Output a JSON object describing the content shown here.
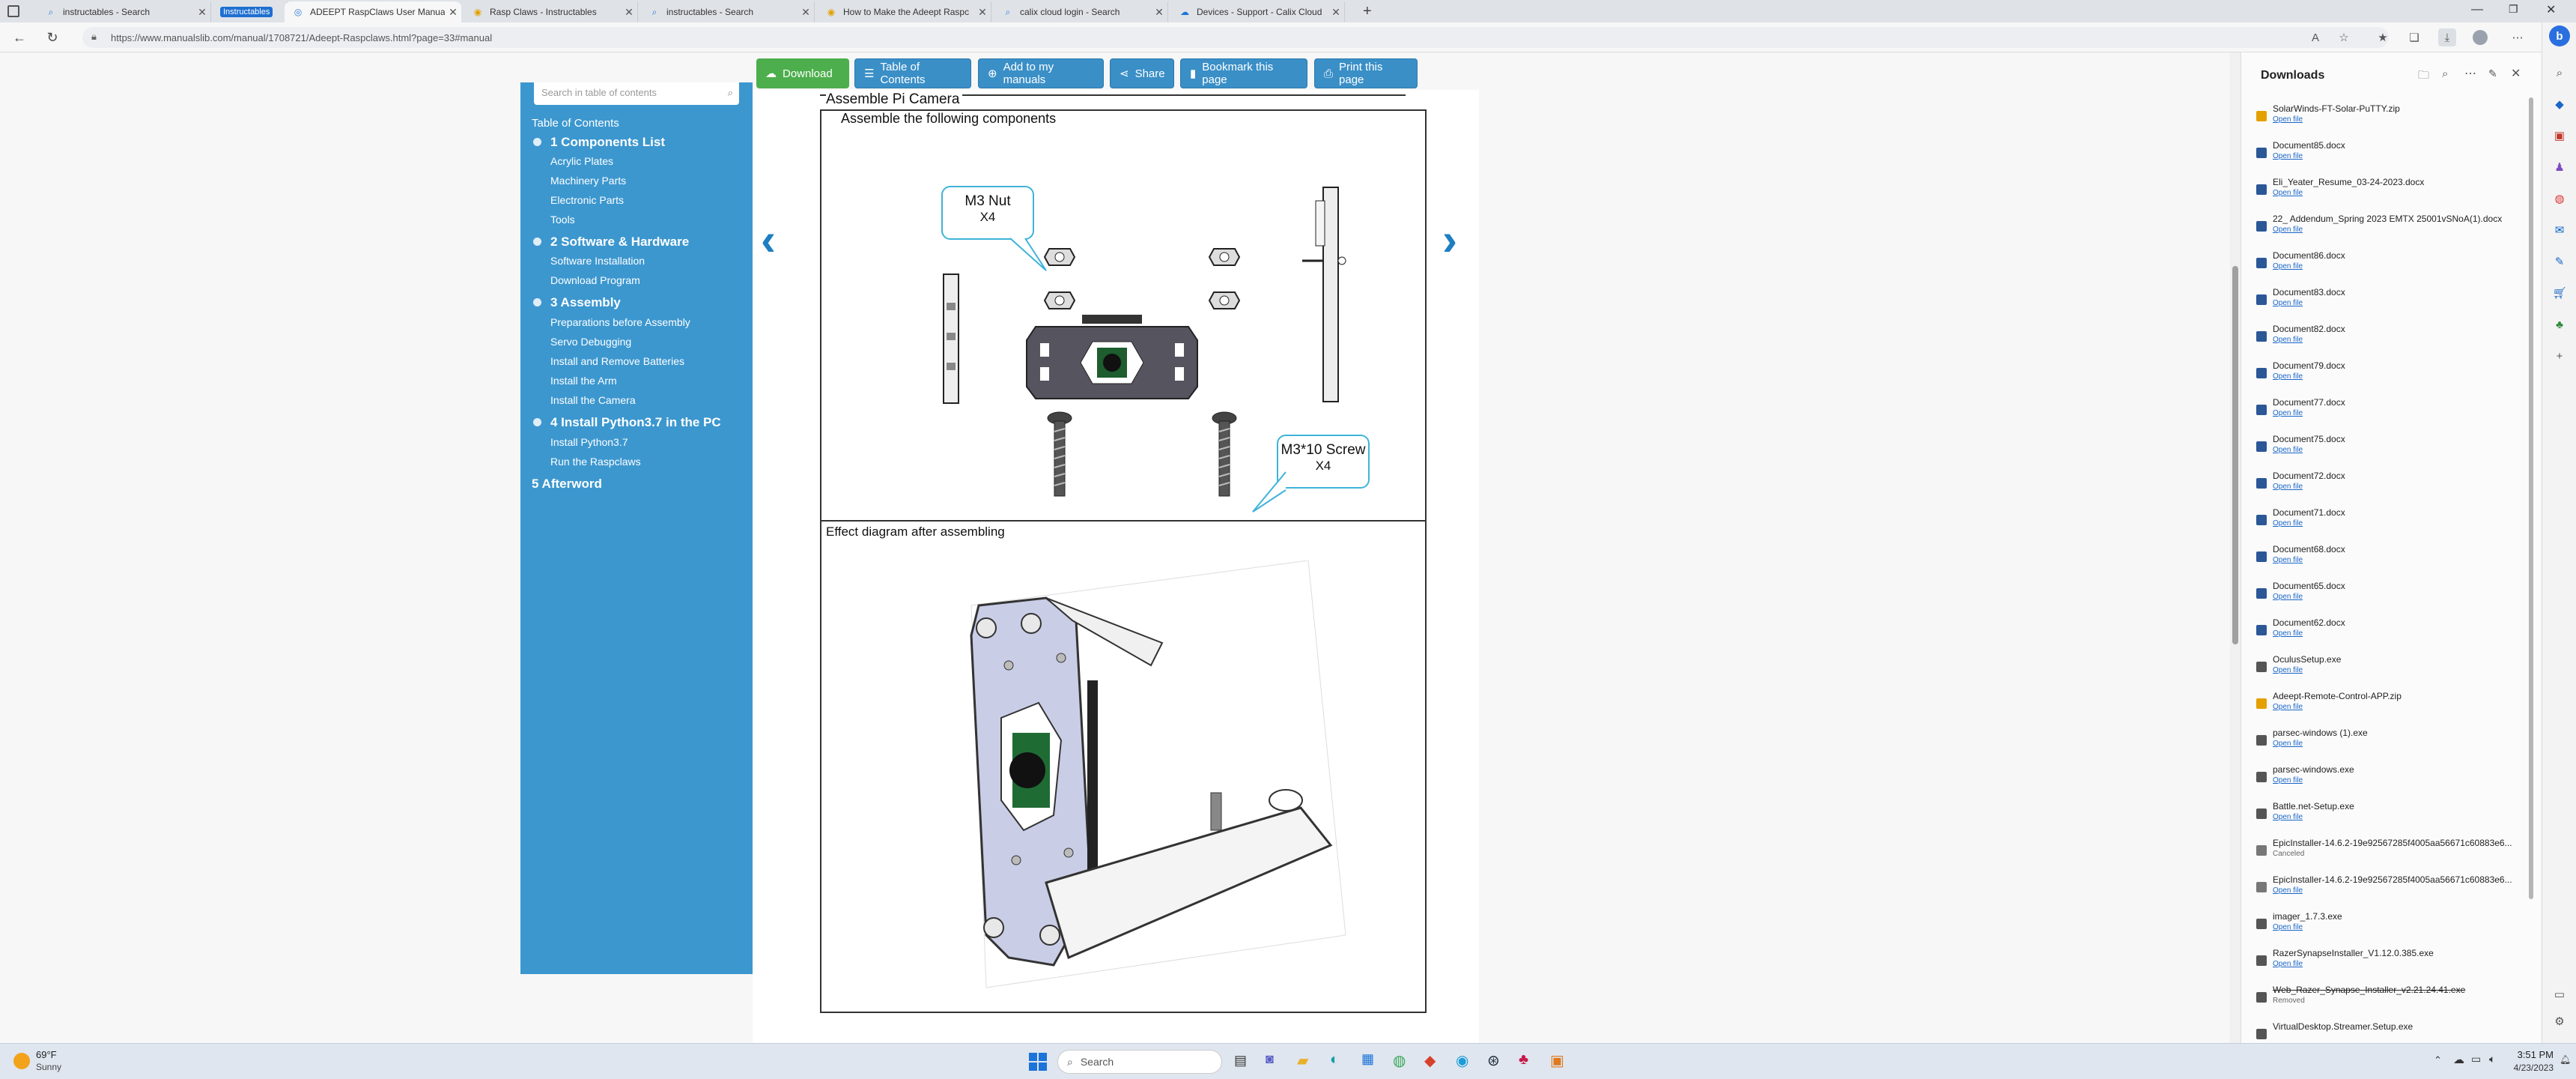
{
  "tabs": [
    {
      "title": "instructables - Search",
      "active": false
    },
    {
      "title": "Instructables",
      "active": false
    },
    {
      "title": "ADEEPT RaspClaws User Manual",
      "active": true
    },
    {
      "title": "Rasp Claws - Instructables",
      "active": false
    },
    {
      "title": "instructables - Search",
      "active": false
    },
    {
      "title": "How to Make the Adeept Raspc",
      "active": false
    },
    {
      "title": "calix cloud login - Search",
      "active": false
    },
    {
      "title": "Devices - Support - Calix Cloud",
      "active": false
    }
  ],
  "address": {
    "url": "https://www.manualslib.com/manual/1708721/Adeept-Raspclaws.html?page=33#manual"
  },
  "toolbar": {
    "download": "Download",
    "toc": "Table of Contents",
    "add": "Add to my manuals",
    "share": "Share",
    "bookmark": "Bookmark this page",
    "print": "Print this page"
  },
  "toc": {
    "search_placeholder": "Search in table of contents",
    "heading": "Table of Contents",
    "chapters": [
      {
        "label": "1 Components List",
        "items": [
          "Acrylic Plates",
          "Machinery Parts",
          "Electronic Parts",
          "Tools"
        ]
      },
      {
        "label": "2 Software & Hardware",
        "items": [
          "Software Installation",
          "Download Program"
        ]
      },
      {
        "label": "3 Assembly",
        "items": [
          "Preparations before Assembly",
          "Servo Debugging",
          "Install and Remove Batteries",
          "Install the Arm",
          "Install the Camera"
        ]
      },
      {
        "label": "4 Install Python3.7 in the PC",
        "items": [
          "Install Python3.7",
          "Run the Raspclaws"
        ]
      }
    ],
    "afterword": "5 Afterword"
  },
  "doc": {
    "section": "Assemble Pi Camera",
    "step1": "Assemble the following components",
    "nut_label": "M3 Nut",
    "nut_qty": "X4",
    "screw_label": "M3*10 Screw",
    "screw_qty": "X4",
    "step2": "Effect diagram after assembling"
  },
  "downloads": {
    "title": "Downloads",
    "open": "Open file",
    "items": [
      {
        "name": "SolarWinds-FT-Solar-PuTTY.zip",
        "status": "Open file"
      },
      {
        "name": "Document85.docx",
        "status": "Open file"
      },
      {
        "name": "Eli_Yeater_Resume_03-24-2023.docx",
        "status": "Open file"
      },
      {
        "name": "22_ Addendum_Spring 2023 EMTX 25001vSNoA(1).docx",
        "status": "Open file"
      },
      {
        "name": "Document86.docx",
        "status": "Open file"
      },
      {
        "name": "Document83.docx",
        "status": "Open file"
      },
      {
        "name": "Document82.docx",
        "status": "Open file"
      },
      {
        "name": "Document79.docx",
        "status": "Open file"
      },
      {
        "name": "Document77.docx",
        "status": "Open file"
      },
      {
        "name": "Document75.docx",
        "status": "Open file"
      },
      {
        "name": "Document72.docx",
        "status": "Open file"
      },
      {
        "name": "Document71.docx",
        "status": "Open file"
      },
      {
        "name": "Document68.docx",
        "status": "Open file"
      },
      {
        "name": "Document65.docx",
        "status": "Open file"
      },
      {
        "name": "Document62.docx",
        "status": "Open file"
      },
      {
        "name": "OculusSetup.exe",
        "status": "Open file"
      },
      {
        "name": "Adeept-Remote-Control-APP.zip",
        "status": "Open file"
      },
      {
        "name": "parsec-windows (1).exe",
        "status": "Open file"
      },
      {
        "name": "parsec-windows.exe",
        "status": "Open file"
      },
      {
        "name": "Battle.net-Setup.exe",
        "status": "Open file"
      },
      {
        "name": "EpicInstaller-14.6.2-19e92567285f4005aa56671c60883e6...",
        "status": "Canceled"
      },
      {
        "name": "EpicInstaller-14.6.2-19e92567285f4005aa56671c60883e6...",
        "status": "Open file"
      },
      {
        "name": "imager_1.7.3.exe",
        "status": "Open file"
      },
      {
        "name": "RazerSynapseInstaller_V1.12.0.385.exe",
        "status": "Open file"
      },
      {
        "name": "Web_Razer_Synapse_Installer_v2.21.24.41.exe",
        "status": "Removed"
      },
      {
        "name": "VirtualDesktop.Streamer.Setup.exe",
        "status": ""
      }
    ]
  },
  "taskbar": {
    "temp": "69°F",
    "weather": "Sunny",
    "search": "Search",
    "time": "3:51 PM",
    "date": "4/23/2023"
  },
  "colors": {
    "toc_bg": "#3c97cf",
    "download_green": "#4cae4c",
    "action_blue": "#3a8fc7",
    "bubble": "#3fb3d8"
  }
}
